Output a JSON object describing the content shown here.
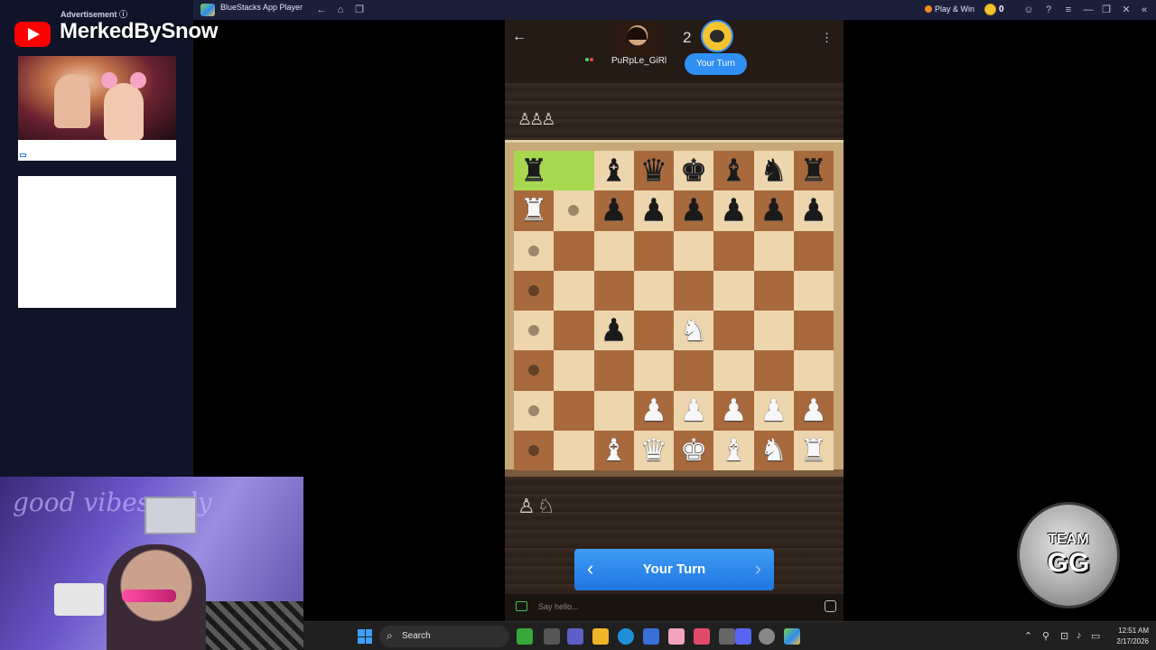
{
  "bluestacks": {
    "title": "BlueStacks App Player",
    "play_win": "Play & Win",
    "coins": "0"
  },
  "ad": {
    "label": "Advertisement ⓘ"
  },
  "banner": {
    "channel_name": "MerkedBySnow"
  },
  "chess": {
    "opponent_name": "PuRpLe_GiRl",
    "opponent_level": "2",
    "turn_badge": "Your Turn",
    "turn_bar": "Your Turn",
    "chat_placeholder": "Say hello...",
    "captured_top": "♙♙♙",
    "captured_bottom": "♙♘",
    "board": [
      [
        "br",
        "hl",
        "bb",
        "bq",
        "bk",
        "bb",
        "bn",
        "br"
      ],
      [
        "wr",
        "dot",
        "bp",
        "bp",
        "bp",
        "bp",
        "bp",
        "bp"
      ],
      [
        "dot",
        "",
        "",
        "",
        "",
        "",
        "",
        ""
      ],
      [
        "dot",
        "",
        "",
        "",
        "",
        "",
        "",
        ""
      ],
      [
        "dot",
        "",
        "bp",
        "",
        "wn",
        "",
        "",
        ""
      ],
      [
        "dot",
        "",
        "",
        "",
        "",
        "",
        "",
        ""
      ],
      [
        "dot",
        "",
        "",
        "wp",
        "wp",
        "wp",
        "wp",
        "wp"
      ],
      [
        "dot",
        "",
        "wb",
        "wq",
        "wk",
        "wb",
        "wn",
        "wr"
      ]
    ],
    "highlight_squares": [
      "a8",
      "b8"
    ]
  },
  "badge": {
    "line1": "TEAM",
    "line2": "GG"
  },
  "webcam": {
    "neon_text": "good vibes only"
  },
  "taskbar": {
    "search_label": "Search",
    "time": "12:51 AM",
    "date": "2/17/2026"
  },
  "colors": {
    "accent_blue": "#2f8ff2",
    "highlight_green": "#a8d84f",
    "light_square": "#edd5ad",
    "dark_square": "#a86a3d"
  }
}
